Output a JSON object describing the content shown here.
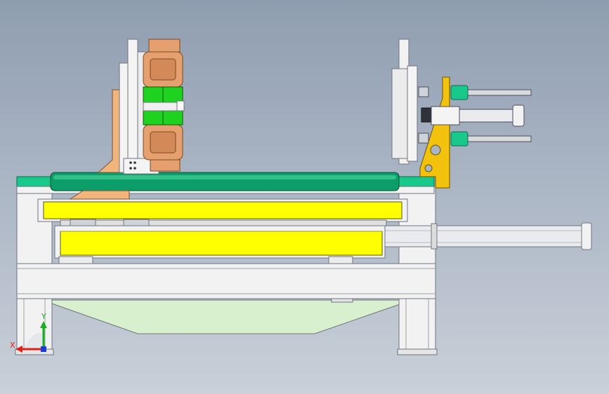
{
  "viewport": {
    "background_top": "#8f9db0",
    "background_bottom": "#c9d0d9"
  },
  "colors": {
    "frame": "#f2f2f2",
    "frame_edge": "#6f7480",
    "slide_yellow": "#ffff00",
    "rail_green": "#0c9e6a",
    "clamp_green": "#1fd21f",
    "copper": "#e6a070",
    "bracket_orange": "#f0b47c",
    "gusset_gold": "#f2c20c",
    "hopper_tint": "#d9f0cf",
    "rod_steel": "#d8dade",
    "fitting_teal": "#19c98b"
  },
  "triad": {
    "x_label": "X",
    "y_label": "Y",
    "x_color": "#e0201a",
    "y_color": "#18b020",
    "z_color": "#1a3bd6"
  }
}
